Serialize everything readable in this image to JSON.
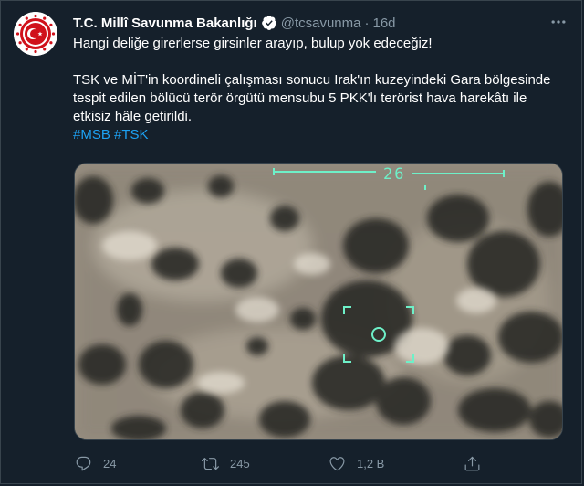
{
  "tweet": {
    "display_name": "T.C. Millî Savunma Bakanlığı",
    "handle": "@tcsavunma",
    "separator": "·",
    "time": "16d",
    "text_line1": "Hangi deliğe girerlerse girsinler arayıp, bulup yok edeceğiz!",
    "text_para2": "TSK ve MİT'in koordineli çalışması sonucu Irak'ın kuzeyindeki Gara bölgesinde tespit edilen bölücü terör örgütü mensubu 5 PKK'lı terörist hava harekâtı ile etkisiz hâle getirildi.",
    "hashtag1": "#MSB",
    "hashtag2": "#TSK",
    "media_overlay_number": "26"
  },
  "actions": {
    "reply_count": "24",
    "retweet_count": "245",
    "like_count": "1,2 B"
  },
  "icons": {
    "verified": "verified-badge-icon",
    "more": "more-icon",
    "reply": "reply-icon",
    "retweet": "retweet-icon",
    "like": "heart-icon",
    "share": "share-icon"
  },
  "colors": {
    "background": "#15202b",
    "text": "#ffffff",
    "muted": "#8899a6",
    "link": "#1da1f2",
    "avatar_red": "#d0111b",
    "hud": "#6ef0c8"
  }
}
